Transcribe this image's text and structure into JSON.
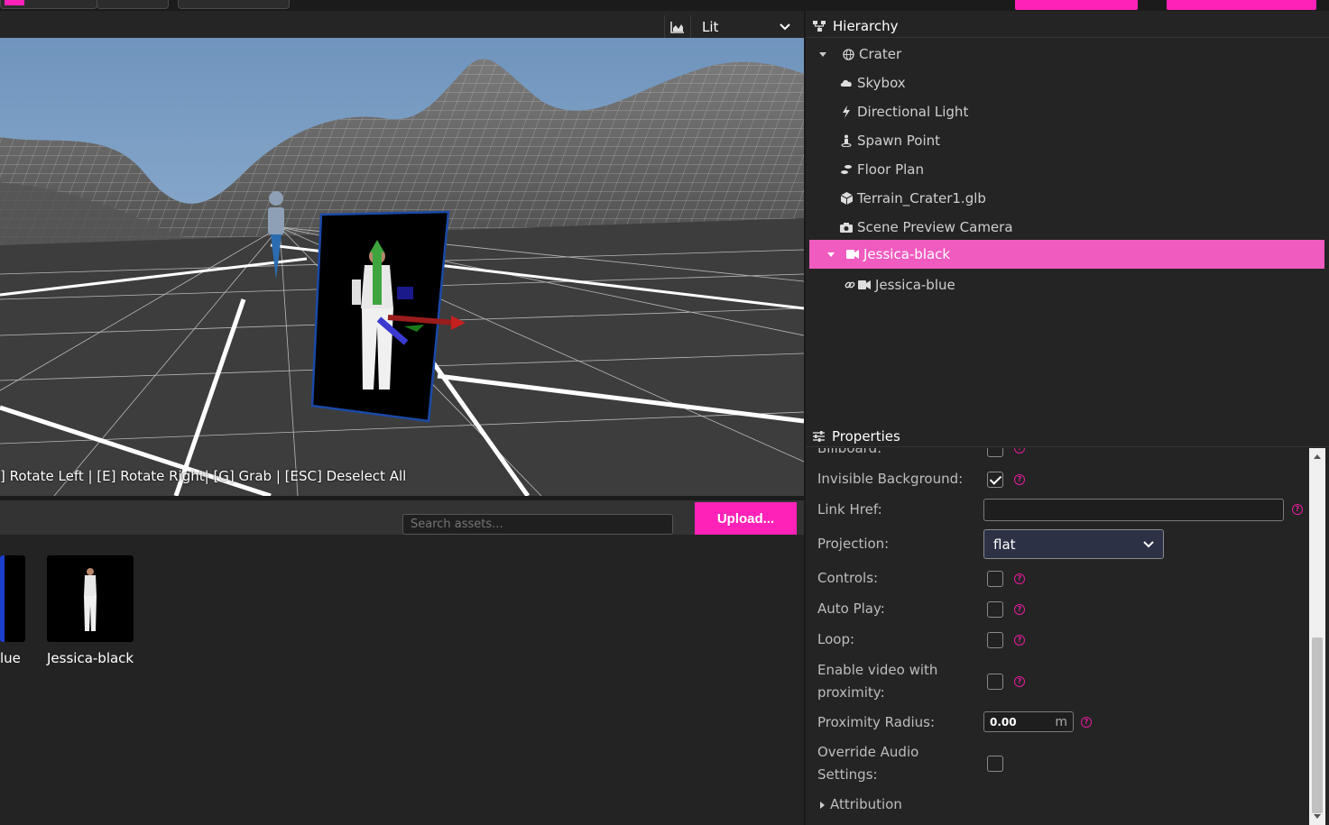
{
  "viewport_toolbar": {
    "render_mode": "Lit"
  },
  "viewport": {
    "hint": "] Rotate Left | [E] Rotate Right| [G] Grab | [ESC] Deselect All"
  },
  "assets": {
    "search_placeholder": "Search assets...",
    "upload_label": "Upload...",
    "items": [
      {
        "label": "lue"
      },
      {
        "label": "Jessica-black"
      }
    ]
  },
  "hierarchy": {
    "title": "Hierarchy",
    "items": [
      {
        "label": "Crater",
        "icon": "globe-icon"
      },
      {
        "label": "Skybox",
        "icon": "cloud-icon"
      },
      {
        "label": "Directional Light",
        "icon": "bolt-icon"
      },
      {
        "label": "Spawn Point",
        "icon": "street-view-icon"
      },
      {
        "label": "Floor Plan",
        "icon": "shoe-prints-icon"
      },
      {
        "label": "Terrain_Crater1.glb",
        "icon": "cube-icon"
      },
      {
        "label": "Scene Preview Camera",
        "icon": "camera-icon"
      },
      {
        "label": "Jessica-black",
        "icon": "video-icon",
        "selected": true
      },
      {
        "label": "Jessica-blue",
        "icon": "video-icon"
      }
    ]
  },
  "properties": {
    "title": "Properties",
    "billboard_label": "Billboard:",
    "invisible_background_label": "Invisible Background:",
    "invisible_background_checked": true,
    "link_href_label": "Link Href:",
    "link_href_value": "",
    "projection_label": "Projection:",
    "projection_value": "flat",
    "controls_label": "Controls:",
    "autoplay_label": "Auto Play:",
    "loop_label": "Loop:",
    "enable_video_label_1": "Enable video with",
    "enable_video_label_2": "proximity:",
    "proximity_radius_label": "Proximity Radius:",
    "proximity_radius_value": "0.00",
    "proximity_radius_unit": "m",
    "override_audio_label_1": "Override Audio",
    "override_audio_label_2": "Settings:",
    "attribution_label": "Attribution",
    "help_symbol": "?"
  },
  "colors": {
    "accent": "#ff22b8",
    "selection": "#f05bbf"
  }
}
